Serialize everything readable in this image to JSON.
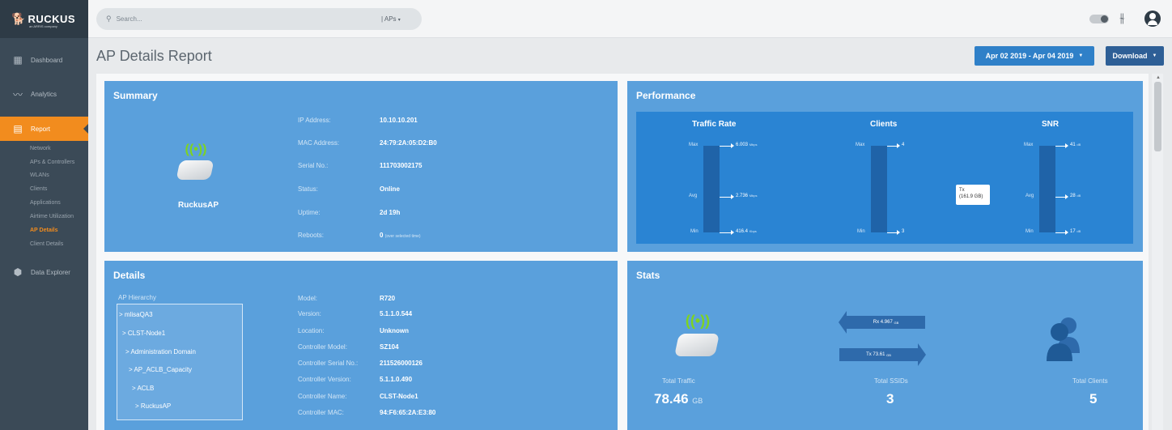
{
  "brand": {
    "name": "RUCKUS",
    "tagline": "an ARRIS company"
  },
  "sidebar": {
    "items": [
      {
        "label": "Dashboard",
        "icon": "dashboard-icon"
      },
      {
        "label": "Analytics",
        "icon": "analytics-icon"
      },
      {
        "label": "Report",
        "icon": "report-icon",
        "active": true
      },
      {
        "label": "Data Explorer",
        "icon": "data-explorer-icon"
      }
    ],
    "report_sub": [
      "Network",
      "APs & Controllers",
      "WLANs",
      "Clients",
      "Applications",
      "Airtime Utilization",
      "AP Details",
      "Client Details"
    ],
    "active_sub": "AP Details"
  },
  "topbar": {
    "search_placeholder": "Search...",
    "search_scope": "| APs",
    "icons": [
      "search-icon",
      "toggle-icon",
      "sliders-icon",
      "user-icon"
    ]
  },
  "header": {
    "title": "AP Details Report",
    "date_range": "Apr 02 2019 - Apr 04 2019",
    "download_label": "Download"
  },
  "summary": {
    "title": "Summary",
    "ap_name": "RuckusAP",
    "fields": [
      {
        "label": "IP Address:",
        "value": "10.10.10.201"
      },
      {
        "label": "MAC Address:",
        "value": "24:79:2A:05:D2:B0"
      },
      {
        "label": "Serial No.:",
        "value": "111703002175"
      },
      {
        "label": "Status:",
        "value": "Online"
      },
      {
        "label": "Uptime:",
        "value": "2d 19h"
      },
      {
        "label": "Reboots:",
        "value": "0",
        "note": "(over selected time)"
      }
    ]
  },
  "performance": {
    "title": "Performance",
    "traffic_rate": {
      "heading": "Traffic Rate",
      "max": "6.003",
      "avg": "2.736",
      "min": "416.4",
      "unit_max": "Mbps",
      "unit_avg": "Mbps",
      "unit_min": "Kbps"
    },
    "clients": {
      "heading": "Clients",
      "max": "4",
      "min": "3"
    },
    "snr": {
      "heading": "SNR",
      "max": "41",
      "avg": "28",
      "min": "17",
      "unit": "dB"
    },
    "labels": {
      "max": "Max",
      "avg": "Avg",
      "min": "Min"
    },
    "tooltip": {
      "line1": "Tx",
      "line2": "(161.9 GB)"
    }
  },
  "details": {
    "title": "Details",
    "hierarchy_label": "AP Hierarchy",
    "hierarchy": [
      "> mlisaQA3",
      "> CLST-Node1",
      "> Administration Domain",
      "> AP_ACLB_Capacity",
      "> ACLB",
      "> RuckusAP"
    ],
    "fields": [
      {
        "label": "Model:",
        "value": "R720"
      },
      {
        "label": "Version:",
        "value": "5.1.1.0.544"
      },
      {
        "label": "Location:",
        "value": "Unknown"
      },
      {
        "label": "Controller Model:",
        "value": "SZ104"
      },
      {
        "label": "Controller Serial No.:",
        "value": "211526000126"
      },
      {
        "label": "Controller Version:",
        "value": "5.1.1.0.490"
      },
      {
        "label": "Controller Name:",
        "value": "CLST-Node1"
      },
      {
        "label": "Controller MAC:",
        "value": "94:F6:65:2A:E3:80"
      }
    ]
  },
  "stats": {
    "title": "Stats",
    "rx": "Rx 4.967",
    "rx_unit": "GB",
    "tx": "Tx 73.61",
    "tx_unit": "GB",
    "total_traffic_label": "Total Traffic",
    "total_traffic": "78.46",
    "total_traffic_unit": "GB",
    "total_ssids_label": "Total SSIDs",
    "total_ssids": "3",
    "total_clients_label": "Total Clients",
    "total_clients": "5"
  },
  "colors": {
    "panel": "#5aa0dc",
    "accent_orange": "#f28c1e",
    "sidebar": "#3b4a57",
    "button": "#2f80c8"
  }
}
